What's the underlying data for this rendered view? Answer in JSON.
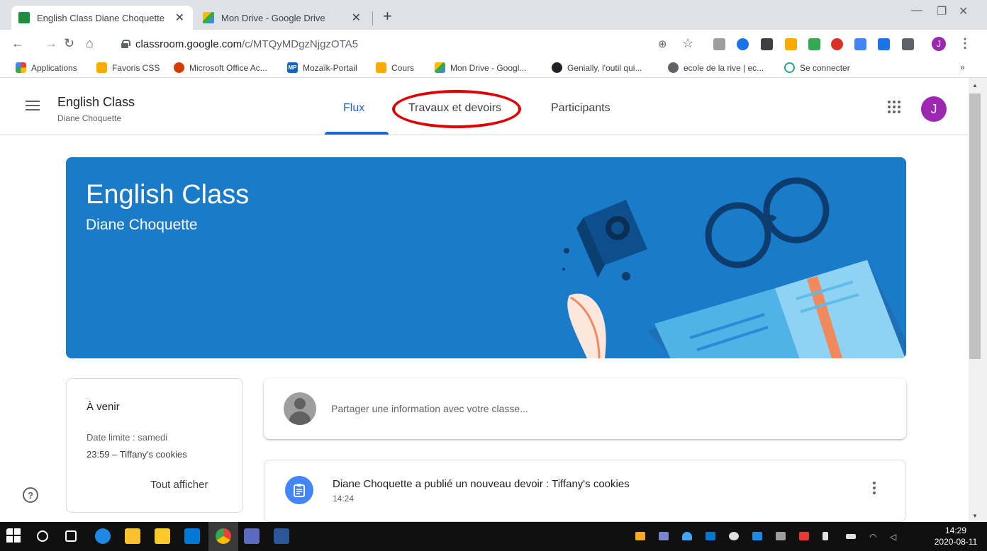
{
  "browser": {
    "tabs": [
      {
        "title": "English Class Diane Choquette",
        "active": true,
        "favicon": "google-classroom-icon",
        "color": "#1e8e3e"
      },
      {
        "title": "Mon Drive - Google Drive",
        "active": false,
        "favicon": "google-drive-icon",
        "color": "#fbbc04"
      }
    ],
    "url_host": "classroom.google.com",
    "url_path": "/c/MTQyMDgzNjgzOTA5",
    "avatar_letter": "J",
    "bookmarks": [
      {
        "label": "Applications",
        "icon": "apps-grid-icon"
      },
      {
        "label": "Favoris CSS",
        "icon": "folder-icon"
      },
      {
        "label": "Microsoft Office Ac...",
        "icon": "office-icon"
      },
      {
        "label": "Mozaïk-Portail",
        "icon": "mp-icon",
        "text": "MP"
      },
      {
        "label": "Cours",
        "icon": "classroom-icon"
      },
      {
        "label": "Mon Drive - Googl...",
        "icon": "drive-icon"
      },
      {
        "label": "Genially, l'outil qui...",
        "icon": "genially-icon"
      },
      {
        "label": "ecole de la rive | ec...",
        "icon": "globe-icon"
      },
      {
        "label": "Se connecter",
        "icon": "login-icon"
      }
    ],
    "overflow": "»"
  },
  "header": {
    "class_name": "English Class",
    "teacher": "Diane Choquette",
    "tabs": [
      "Flux",
      "Travaux et devoirs",
      "Participants"
    ],
    "active_tab": "Flux",
    "avatar_letter": "J",
    "avatar_color": "#9c27b0",
    "accent": "#1967d2"
  },
  "banner": {
    "title": "English Class",
    "subtitle": "Diane Choquette",
    "color": "#1a7bc8"
  },
  "upcoming": {
    "title": "À venir",
    "due_line": "Date limite : samedi",
    "item_line": "23:59 – Tiffany's cookies",
    "view_all": "Tout afficher"
  },
  "stream": {
    "share_placeholder": "Partager une information avec votre classe...",
    "posts": [
      {
        "title": "Diane Choquette a publié un nouveau devoir : Tiffany's cookies",
        "time": "14:24",
        "icon": "assignment-icon"
      }
    ]
  },
  "taskbar": {
    "time": "14:29",
    "date": "2020-08-11"
  }
}
